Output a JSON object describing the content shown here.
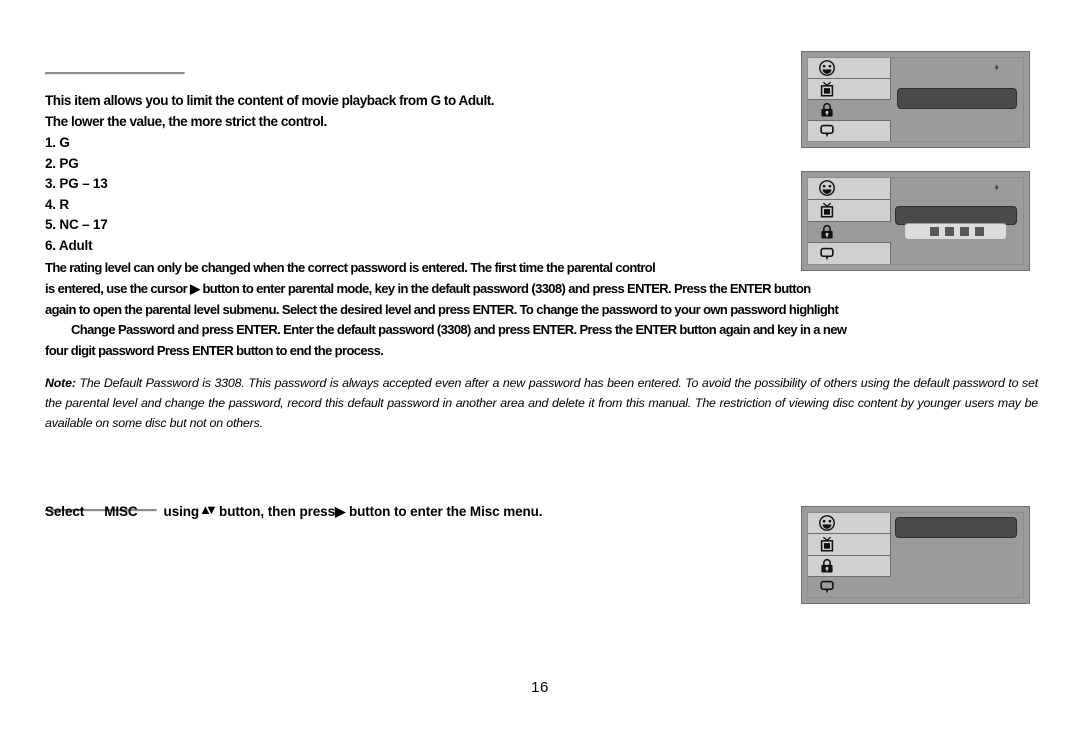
{
  "document": {
    "page_number": "16"
  },
  "parental": {
    "intro_line_1": "This item allows you to limit the content of movie playback from G to Adult.",
    "intro_line_2": "The lower the value, the more strict the control.",
    "rating_levels": [
      "1. G",
      "2. PG",
      "3. PG – 13",
      "4. R",
      "5. NC – 17",
      "6. Adult"
    ],
    "description_lines": [
      "The rating level can only be changed when the correct password is entered. The first time the parental control",
      "is entered, use the cursor ▶ button to enter parental mode, key in the default password (3308) and press ENTER. Press the ENTER button",
      "again to open the parental level submenu. Select the desired level and press ENTER.  To change the password to your own password highlight",
      "Change Password and press ENTER.  Enter the default password (3308) and press ENTER.  Press the  ENTER button again and key in a new",
      "four digit password Press ENTER button to end the process."
    ]
  },
  "note": {
    "label": "Note:",
    "text": "The Default Password is 3308. This password is always accepted even after a new password has been entered.  To avoid the possibility of others using the default password to set the parental level and change the password, record this default password in another area and delete it from this manual.  The restriction of viewing disc content by younger users may be available on some disc but not on others."
  },
  "misc": {
    "text_part_1": "Select",
    "text_part_2": "MISC",
    "text_part_3": "using",
    "arrow_up": "▲",
    "arrow_down": "▼",
    "text_part_4": "button, then press",
    "arrow_right": "▶",
    "text_part_5": "button to enter the Misc menu."
  },
  "osd_panels": [
    {
      "id": "parental-1",
      "items": [
        {
          "icon": "disc-smiley-icon",
          "selected": false
        },
        {
          "icon": "tv-icon",
          "selected": false
        },
        {
          "icon": "lock-icon",
          "selected": true
        },
        {
          "icon": "display-bubble-icon",
          "selected": false
        }
      ],
      "corner_glyph": "♦",
      "highlight_bar": true,
      "password_field": false
    },
    {
      "id": "parental-2",
      "items": [
        {
          "icon": "disc-smiley-icon",
          "selected": false
        },
        {
          "icon": "tv-icon",
          "selected": false
        },
        {
          "icon": "lock-icon",
          "selected": true
        },
        {
          "icon": "display-bubble-icon",
          "selected": false
        }
      ],
      "corner_glyph": "♦",
      "highlight_bar": true,
      "password_field": true,
      "password_digits": 4
    },
    {
      "id": "misc",
      "items": [
        {
          "icon": "disc-smiley-icon",
          "selected": false
        },
        {
          "icon": "tv-icon",
          "selected": false
        },
        {
          "icon": "lock-icon",
          "selected": false
        },
        {
          "icon": "display-bubble-icon",
          "selected": true
        }
      ],
      "corner_glyph": "",
      "highlight_bar": true,
      "password_field": false
    }
  ],
  "colors": {
    "panel_bg": "#9b9b9b",
    "panel_item_bg": "#d0d0d0",
    "highlight_bar": "#4a4a4a",
    "password_field": "#dcdcdc",
    "rule": "#8a8a8a"
  }
}
